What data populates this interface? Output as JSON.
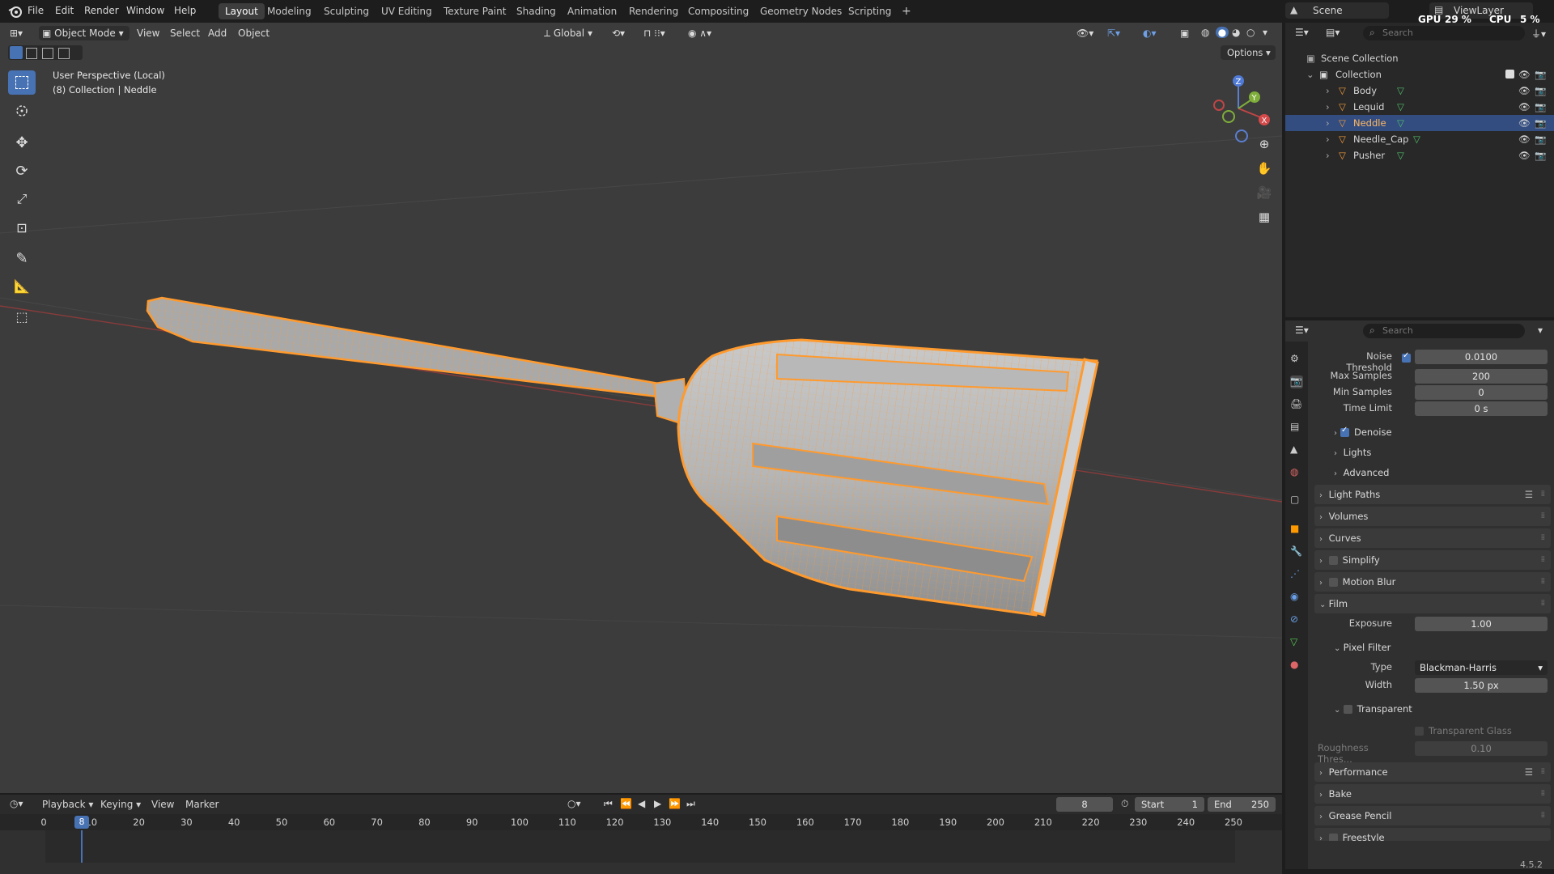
{
  "app": {
    "version": "4.5.2"
  },
  "menu": [
    "File",
    "Edit",
    "Render",
    "Window",
    "Help"
  ],
  "workspaces": [
    {
      "label": "Layout",
      "active": true
    },
    {
      "label": "Modeling"
    },
    {
      "label": "Sculpting"
    },
    {
      "label": "UV Editing"
    },
    {
      "label": "Texture Paint"
    },
    {
      "label": "Shading"
    },
    {
      "label": "Animation"
    },
    {
      "label": "Rendering"
    },
    {
      "label": "Compositing"
    },
    {
      "label": "Geometry Nodes"
    },
    {
      "label": "Scripting"
    }
  ],
  "add_workspace": "+",
  "scene": {
    "name": "Scene",
    "view_layer": "ViewLayer",
    "gpu_label": "GPU",
    "gpu": "29 %",
    "cpu_label": "CPU",
    "cpu": "5 %"
  },
  "viewport": {
    "mode": "Object Mode",
    "menus": [
      "View",
      "Select",
      "Add",
      "Object"
    ],
    "transform_orientation": "Global",
    "options_label": "Options",
    "info_line1": "User Perspective (Local)",
    "info_line2": "(8) Collection | Neddle",
    "gizmo": {
      "x": "X",
      "y": "Y",
      "z": "Z"
    }
  },
  "tools": [
    "select-box",
    "cursor",
    "move",
    "rotate",
    "scale",
    "transform",
    "annotate",
    "measure",
    "add-cube"
  ],
  "outliner": {
    "search_placeholder": "Search",
    "root": "Scene Collection",
    "collection": "Collection",
    "items": [
      {
        "name": "Body",
        "selected": false
      },
      {
        "name": "Lequid",
        "selected": false
      },
      {
        "name": "Neddle",
        "selected": true
      },
      {
        "name": "Needle_Cap",
        "selected": false
      },
      {
        "name": "Pusher",
        "selected": false
      }
    ]
  },
  "properties": {
    "search_placeholder": "Search",
    "noise_threshold": {
      "label": "Noise Threshold",
      "value": "0.0100"
    },
    "max_samples": {
      "label": "Max Samples",
      "value": "200"
    },
    "min_samples": {
      "label": "Min Samples",
      "value": "0"
    },
    "time_limit": {
      "label": "Time Limit",
      "value": "0 s"
    },
    "denoise": "Denoise",
    "lights": "Lights",
    "advanced": "Advanced",
    "panels": {
      "light_paths": "Light Paths",
      "volumes": "Volumes",
      "curves": "Curves",
      "simplify": "Simplify",
      "motion_blur": "Motion Blur",
      "film": "Film",
      "performance": "Performance",
      "bake": "Bake",
      "grease_pencil": "Grease Pencil",
      "freestyle": "Freestyle"
    },
    "exposure": {
      "label": "Exposure",
      "value": "1.00"
    },
    "pixel_filter": "Pixel Filter",
    "filter_type": {
      "label": "Type",
      "value": "Blackman-Harris"
    },
    "filter_width": {
      "label": "Width",
      "value": "1.50 px"
    },
    "transparent": "Transparent",
    "transparent_glass": "Transparent Glass",
    "roughness_thresh": {
      "label": "Roughness Thres...",
      "value": "0.10"
    }
  },
  "timeline": {
    "menus": [
      "Playback",
      "Keying",
      "View",
      "Marker"
    ],
    "current_frame": "8",
    "start_label": "Start",
    "start": "1",
    "end_label": "End",
    "end": "250",
    "ruler": [
      "0",
      "10",
      "20",
      "30",
      "40",
      "50",
      "60",
      "70",
      "80",
      "90",
      "100",
      "110",
      "120",
      "130",
      "140",
      "150",
      "160",
      "170",
      "180",
      "190",
      "200",
      "210",
      "220",
      "230",
      "240",
      "250"
    ]
  },
  "colors": {
    "accent": "#4772b3",
    "selection_orange": "#ff9a2e",
    "viewport_bg": "#3c3c3c"
  }
}
